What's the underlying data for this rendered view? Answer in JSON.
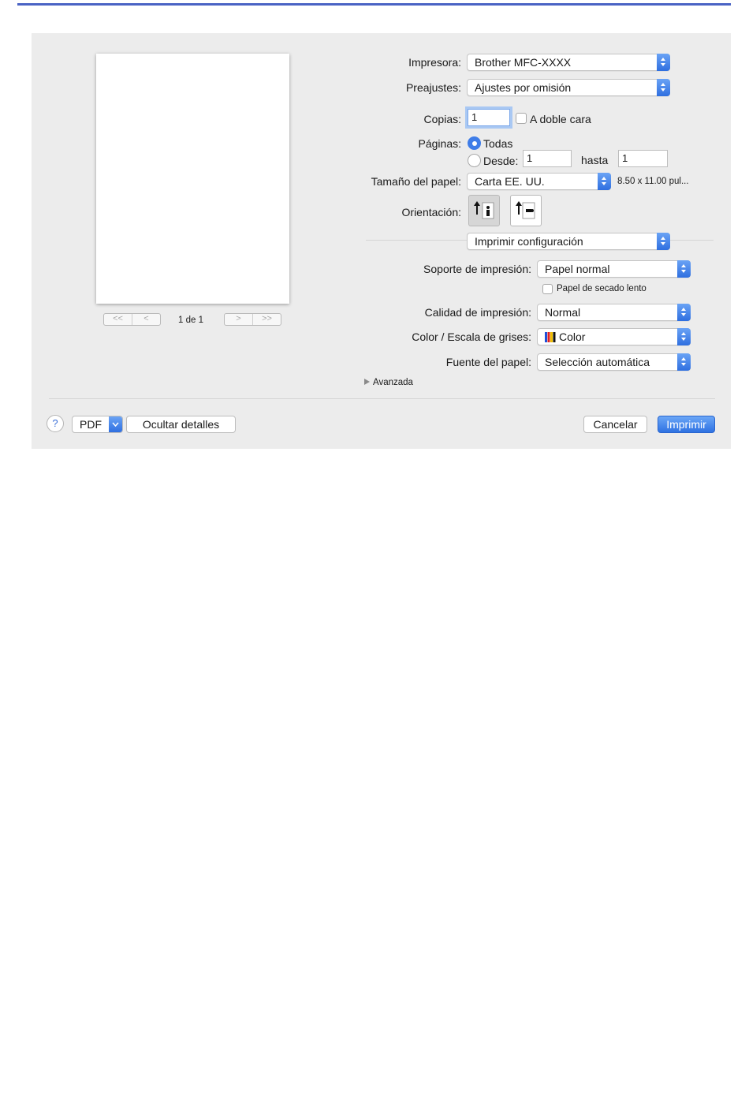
{
  "dialog": {
    "preview": {
      "page_counter": "1 de 1",
      "nav_first": "<<",
      "nav_prev": "<",
      "nav_next": ">",
      "nav_last": ">>"
    },
    "printer": {
      "label": "Impresora:",
      "value": "Brother MFC-XXXX"
    },
    "presets": {
      "label": "Preajustes:",
      "value": "Ajustes por omisión"
    },
    "copies": {
      "label": "Copias:",
      "value": "1",
      "duplex_label": "A doble cara",
      "duplex_checked": false
    },
    "pages": {
      "label": "Páginas:",
      "all_label": "Todas",
      "all_selected": true,
      "from_label": "Desde:",
      "from_value": "1",
      "to_label": "hasta",
      "to_value": "1"
    },
    "paper_size": {
      "label": "Tamaño del papel:",
      "value": "Carta EE. UU.",
      "dimensions": "8.50 x 11.00 pul..."
    },
    "orientation": {
      "label": "Orientación:",
      "selected": "portrait"
    },
    "section": {
      "value": "Imprimir configuración"
    },
    "media_type": {
      "label": "Soporte de impresión:",
      "value": "Papel normal",
      "slow_dry_label": "Papel de secado lento",
      "slow_dry_checked": false
    },
    "quality": {
      "label": "Calidad de impresión:",
      "value": "Normal"
    },
    "color_mode": {
      "label": "Color / Escala de grises:",
      "value": "Color"
    },
    "paper_source": {
      "label": "Fuente del papel:",
      "value": "Selección automática"
    },
    "advanced": {
      "label": "Avanzada"
    },
    "footer": {
      "help": "?",
      "pdf": "PDF",
      "hide_details": "Ocultar detalles",
      "cancel": "Cancelar",
      "print": "Imprimir"
    }
  },
  "colors": {
    "accent": "#3f7de8",
    "top_rule": "#4a63c4",
    "dialog_bg": "#ececec"
  }
}
